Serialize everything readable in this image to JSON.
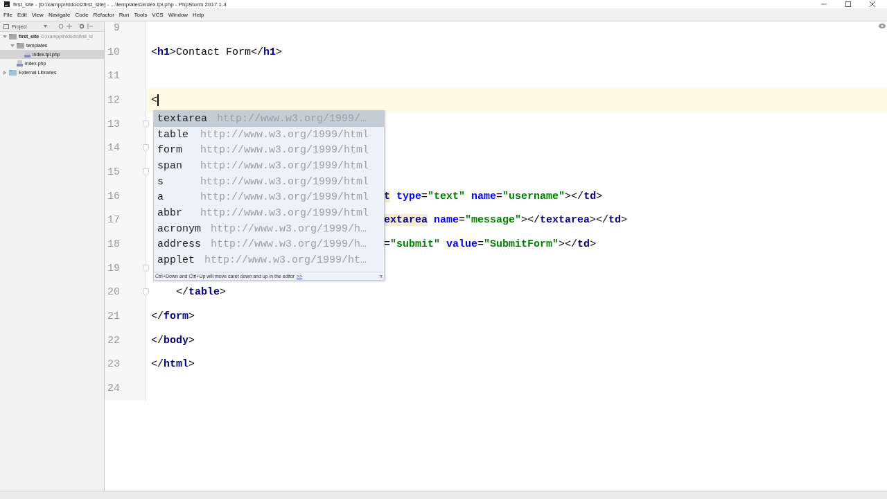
{
  "window": {
    "title": "first_site - [D:\\xampp\\htdocs\\first_site] - ...\\templates\\index.tpl.php - PhpStorm 2017.1.4"
  },
  "menu": [
    "File",
    "Edit",
    "View",
    "Navigate",
    "Code",
    "Refactor",
    "Run",
    "Tools",
    "VCS",
    "Window",
    "Help"
  ],
  "project_panel": {
    "title": "Project",
    "tree": [
      {
        "label": "first_site",
        "path": "D:\\xampp\\htdocs\\first_si",
        "kind": "folder",
        "expanded": true,
        "selected": false,
        "children": [
          {
            "label": "templates",
            "kind": "folder",
            "expanded": true,
            "selected": false,
            "children": [
              {
                "label": "index.tpl.php",
                "kind": "file",
                "selected": true
              }
            ]
          },
          {
            "label": "index.php",
            "kind": "file",
            "selected": false
          }
        ]
      },
      {
        "label": "External Libraries",
        "kind": "library",
        "expanded": false,
        "selected": false
      }
    ]
  },
  "editor": {
    "lines": [
      {
        "number": "9",
        "fold": false,
        "current": false
      },
      {
        "number": "10",
        "kind": "plain",
        "fold": false,
        "current": false,
        "tokens": [
          {
            "t": "<",
            "kind": "punct"
          },
          {
            "t": "h1",
            "kind": "tag"
          },
          {
            "t": ">Contact Form</",
            "kind": "punct"
          },
          {
            "t": "h1",
            "kind": "tag"
          },
          {
            "t": ">",
            "kind": "punct"
          }
        ]
      },
      {
        "number": "11",
        "fold": false,
        "current": false
      },
      {
        "number": "12",
        "kind": "plain",
        "fold": false,
        "current": true,
        "tokens": [
          {
            "t": "<",
            "kind": "punct"
          }
        ]
      },
      {
        "number": "13",
        "fold": true,
        "current": false
      },
      {
        "number": "14",
        "fold": true,
        "current": false
      },
      {
        "number": "15",
        "fold": true,
        "current": false
      },
      {
        "number": "16",
        "kind": "covered",
        "fold": false,
        "current": false,
        "tokens": [
          {
            "t": "t",
            "kind": "tag",
            "matched": true
          },
          {
            "t": " type",
            "kind": "attr"
          },
          {
            "t": "=",
            "kind": "punct"
          },
          {
            "t": "\"text\"",
            "kind": "value"
          },
          {
            "t": " name",
            "kind": "attr"
          },
          {
            "t": "=",
            "kind": "punct"
          },
          {
            "t": "\"username\"",
            "kind": "value"
          },
          {
            "t": "></",
            "kind": "punct"
          },
          {
            "t": "td",
            "kind": "tag"
          },
          {
            "t": ">",
            "kind": "punct"
          }
        ]
      },
      {
        "number": "17",
        "kind": "covered",
        "fold": false,
        "current": false,
        "tokens": [
          {
            "t": "extarea",
            "kind": "tag",
            "matched": true
          },
          {
            "t": " name",
            "kind": "attr"
          },
          {
            "t": "=",
            "kind": "punct"
          },
          {
            "t": "\"message\"",
            "kind": "value"
          },
          {
            "t": "></",
            "kind": "punct"
          },
          {
            "t": "textarea",
            "kind": "tag"
          },
          {
            "t": "></",
            "kind": "punct"
          },
          {
            "t": "td",
            "kind": "tag"
          },
          {
            "t": ">",
            "kind": "punct"
          }
        ]
      },
      {
        "number": "18",
        "kind": "covered",
        "fold": false,
        "current": false,
        "tokens": [
          {
            "t": "=",
            "kind": "punct"
          },
          {
            "t": "\"submit\"",
            "kind": "value"
          },
          {
            "t": " value",
            "kind": "attr"
          },
          {
            "t": "=",
            "kind": "punct"
          },
          {
            "t": "\"SubmitForm\"",
            "kind": "value"
          },
          {
            "t": "></",
            "kind": "punct"
          },
          {
            "t": "td",
            "kind": "tag"
          },
          {
            "t": ">",
            "kind": "punct"
          }
        ]
      },
      {
        "number": "19",
        "fold": true,
        "current": false
      },
      {
        "number": "20",
        "kind": "plain",
        "fold": true,
        "current": false,
        "tokens": [
          {
            "t": "    </",
            "kind": "punct"
          },
          {
            "t": "table",
            "kind": "tag"
          },
          {
            "t": ">",
            "kind": "punct"
          }
        ]
      },
      {
        "number": "21",
        "kind": "plain",
        "fold": false,
        "current": false,
        "tokens": [
          {
            "t": "</",
            "kind": "punct"
          },
          {
            "t": "form",
            "kind": "tag"
          },
          {
            "t": ">",
            "kind": "punct"
          }
        ]
      },
      {
        "number": "22",
        "kind": "plain",
        "fold": false,
        "current": false,
        "tokens": [
          {
            "t": "</",
            "kind": "punct"
          },
          {
            "t": "body",
            "kind": "tag"
          },
          {
            "t": ">",
            "kind": "punct"
          }
        ]
      },
      {
        "number": "23",
        "kind": "plain",
        "fold": false,
        "current": false,
        "tokens": [
          {
            "t": "</",
            "kind": "punct"
          },
          {
            "t": "html",
            "kind": "tag"
          },
          {
            "t": ">",
            "kind": "punct"
          }
        ]
      },
      {
        "number": "24",
        "fold": false,
        "current": false
      }
    ]
  },
  "completion": {
    "items": [
      {
        "name": "textarea",
        "namespace": "http://www.w3.org/1999/…",
        "selected": true
      },
      {
        "name": "table",
        "namespace": "http://www.w3.org/1999/html",
        "selected": false
      },
      {
        "name": "form",
        "namespace": "http://www.w3.org/1999/html",
        "selected": false
      },
      {
        "name": "span",
        "namespace": "http://www.w3.org/1999/html",
        "selected": false
      },
      {
        "name": "s",
        "namespace": "http://www.w3.org/1999/html",
        "selected": false
      },
      {
        "name": "a",
        "namespace": "http://www.w3.org/1999/html",
        "selected": false
      },
      {
        "name": "abbr",
        "namespace": "http://www.w3.org/1999/html",
        "selected": false
      },
      {
        "name": "acronym",
        "namespace": "http://www.w3.org/1999/h…",
        "selected": false
      },
      {
        "name": "address",
        "namespace": "http://www.w3.org/1999/h…",
        "selected": false
      },
      {
        "name": "applet",
        "namespace": "http://www.w3.org/1999/ht…",
        "selected": false
      }
    ],
    "hint": "Ctrl+Down and Ctrl+Up will move caret down and up in the editor",
    "hint_link": ">>",
    "pi": "π"
  }
}
